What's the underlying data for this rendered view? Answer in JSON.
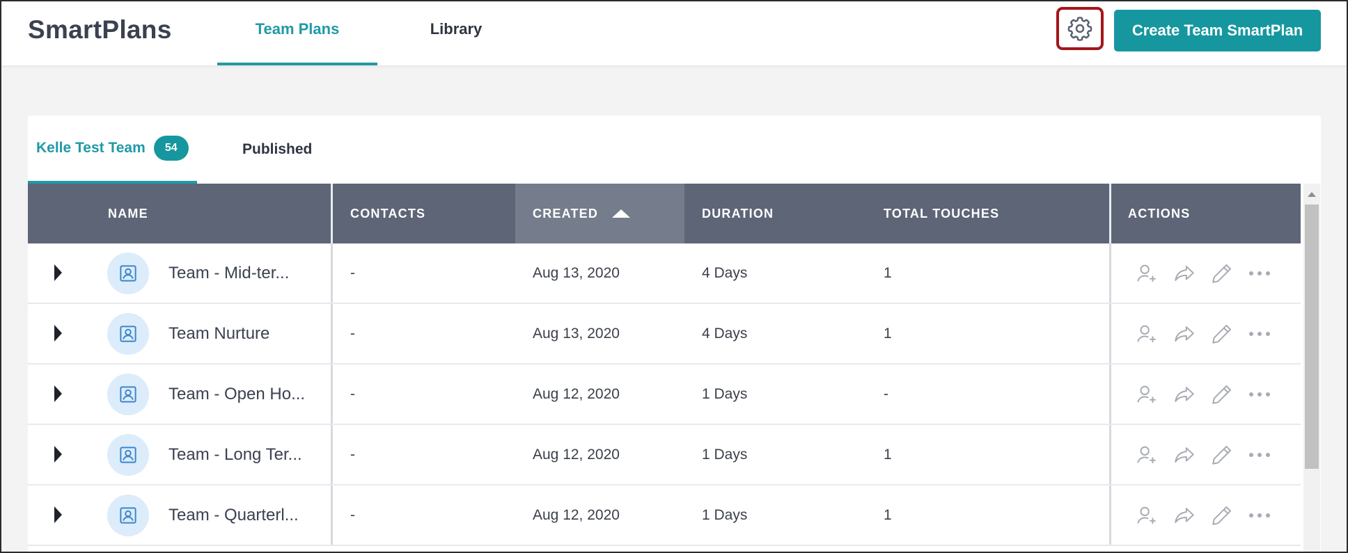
{
  "app": {
    "title": "SmartPlans"
  },
  "header": {
    "tabs": [
      {
        "label": "Team Plans",
        "active": true
      },
      {
        "label": "Library",
        "active": false
      }
    ],
    "settings_icon": "gear-icon",
    "create_button": "Create Team SmartPlan"
  },
  "subtabs": {
    "team": {
      "label": "Kelle Test Team",
      "count": "54"
    },
    "published": {
      "label": "Published"
    }
  },
  "table": {
    "columns": {
      "name": "NAME",
      "contacts": "CONTACTS",
      "created": "CREATED",
      "duration": "DURATION",
      "total_touches": "TOTAL TOUCHES",
      "actions": "ACTIONS"
    },
    "sorted_by": "CREATED",
    "sort_direction": "ascending",
    "rows": [
      {
        "name": "Team - Mid-ter...",
        "contacts": "-",
        "created": "Aug 13, 2020",
        "duration": "4 Days",
        "touches": "1"
      },
      {
        "name": "Team Nurture",
        "contacts": "-",
        "created": "Aug 13, 2020",
        "duration": "4 Days",
        "touches": "1"
      },
      {
        "name": "Team - Open Ho...",
        "contacts": "-",
        "created": "Aug 12, 2020",
        "duration": "1 Days",
        "touches": "-"
      },
      {
        "name": "Team - Long Ter...",
        "contacts": "-",
        "created": "Aug 12, 2020",
        "duration": "1 Days",
        "touches": "1"
      },
      {
        "name": "Team - Quarterl...",
        "contacts": "-",
        "created": "Aug 12, 2020",
        "duration": "1 Days",
        "touches": "1"
      }
    ],
    "row_action_icons": [
      "add-contact-icon",
      "share-icon",
      "edit-pencil-icon",
      "more-dots-icon"
    ]
  },
  "colors": {
    "accent": "#16979f",
    "header_bg": "#5d6577",
    "sorted_header_bg": "#757c8b",
    "highlight_border": "#a4161a",
    "avatar_bg": "#dcecfa",
    "avatar_icon": "#3b86cc"
  }
}
